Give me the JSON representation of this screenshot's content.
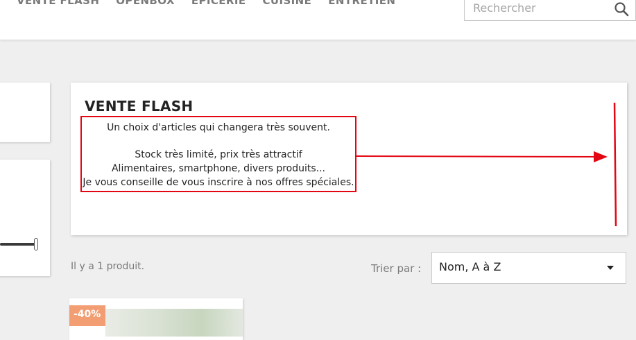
{
  "header": {
    "nav": [
      {
        "label": "VENTE FLASH"
      },
      {
        "label": "OPENBOX"
      },
      {
        "label": "ÉPICERIE"
      },
      {
        "label": "CUISINE"
      },
      {
        "label": "ENTRETIEN"
      }
    ],
    "search": {
      "placeholder": "Rechercher",
      "icon": "search-icon"
    }
  },
  "category": {
    "title": "VENTE FLASH",
    "description": [
      "Un choix d'articles qui changera très souvent.",
      "Stock très limité, prix très attractif",
      "Alimentaires, smartphone, divers produits...",
      "Je vous conseille de vous inscrire à nos offres spéciales."
    ],
    "annotation_color": "#e30613"
  },
  "products_toolbar": {
    "count_text": "Il y a 1 produit.",
    "sort_label": "Trier par :",
    "sort_selected": "Nom, A à Z"
  },
  "product": {
    "discount_badge": "-40%",
    "badge_color": "#f39d72"
  }
}
